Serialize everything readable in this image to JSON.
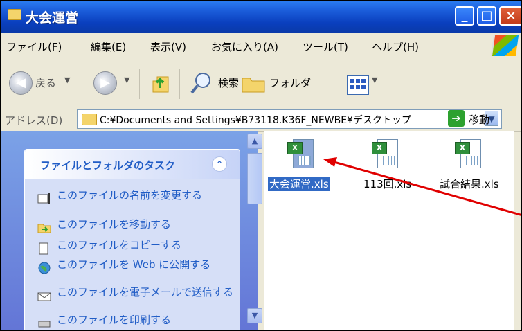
{
  "window": {
    "title": "大会運営"
  },
  "menu": [
    "ファイル(F)",
    "編集(E)",
    "表示(V)",
    "お気に入り(A)",
    "ツール(T)",
    "ヘルプ(H)"
  ],
  "toolbar": {
    "back_label": "戻る",
    "search_label": "検索",
    "folders_label": "フォルダ"
  },
  "address": {
    "label": "アドレス(D)",
    "value": "C:¥Documents and Settings¥B73118.K36F_NEWBE¥デスクトップ",
    "go_label": "移動"
  },
  "task_panel": {
    "title": "ファイルとフォルダのタスク",
    "tasks": [
      "このファイルの名前を変更する",
      "このファイルを移動する",
      "このファイルをコピーする",
      "このファイルを Web に公開する",
      "このファイルを電子メールで送信する",
      "このファイルを印刷する"
    ]
  },
  "files": [
    {
      "name": "大会運営.xls",
      "selected": true
    },
    {
      "name": "113回.xls",
      "selected": false
    },
    {
      "name": "試合結果.xls",
      "selected": false
    }
  ],
  "colors": {
    "title_blue": "#0a3fbe",
    "task_blue": "#215dc6",
    "selection": "#316ac5",
    "arrow": "#e00000"
  }
}
